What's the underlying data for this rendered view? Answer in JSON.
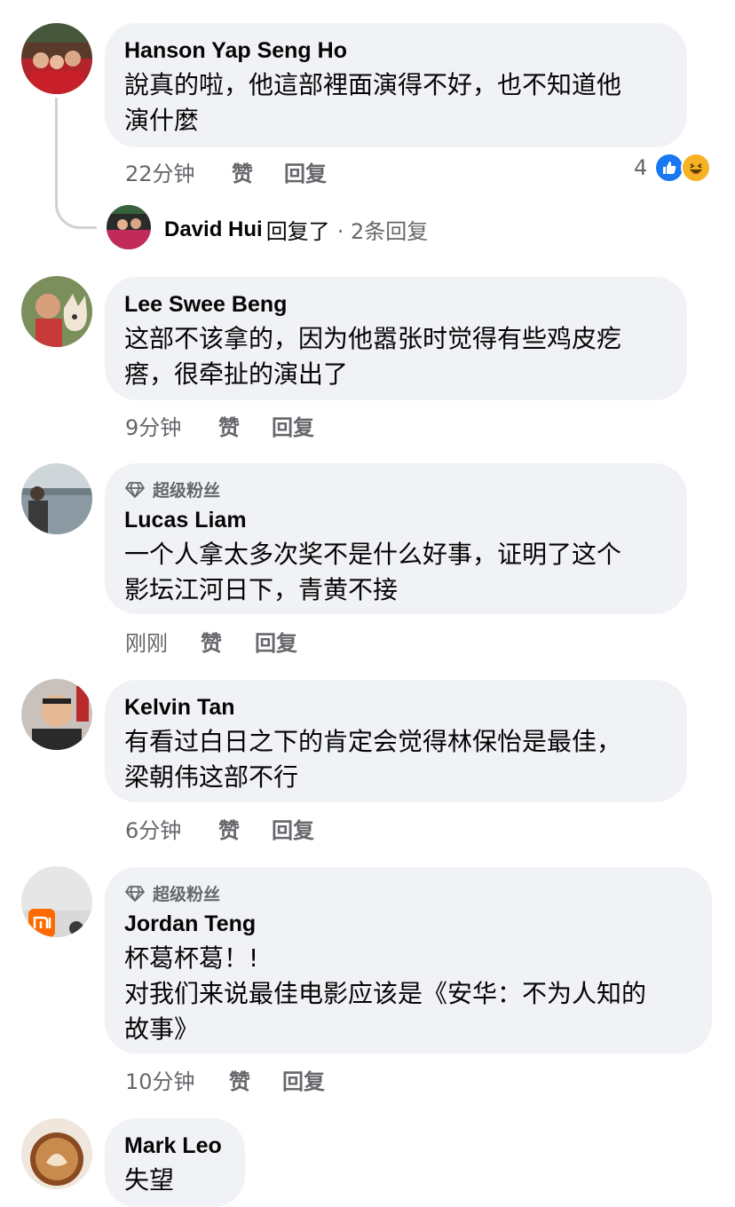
{
  "comments": [
    {
      "author": "Hanson Yap Seng Ho",
      "lines": [
        "說真的啦，他這部裡面演得不好，也不知道他",
        "演什麼"
      ],
      "time": "22分钟",
      "like": "赞",
      "reply": "回复",
      "reaction_count": "4",
      "reaction_icons": [
        "like-reaction-icon",
        "haha-reaction-icon"
      ],
      "replies_preview": {
        "author": "David Hui",
        "action": "回复了",
        "count": "· 2条回复"
      }
    },
    {
      "author": "Lee Swee Beng",
      "lines": [
        "这部不该拿的，因为他嚣张时觉得有些鸡皮疙",
        "瘩，很牵扯的演出了"
      ],
      "time": "9分钟",
      "like": "赞",
      "reply": "回复"
    },
    {
      "badge": "超级粉丝",
      "author": "Lucas Liam",
      "lines": [
        "一个人拿太多次奖不是什么好事，证明了这个",
        "影坛江河日下，青黄不接"
      ],
      "time": "刚刚",
      "like": "赞",
      "reply": "回复"
    },
    {
      "author": "Kelvin Tan",
      "lines": [
        "有看过白日之下的肯定会觉得林保怡是最佳，",
        "梁朝伟这部不行"
      ],
      "time": "6分钟",
      "like": "赞",
      "reply": "回复"
    },
    {
      "badge": "超级粉丝",
      "author": "Jordan Teng",
      "lines": [
        "杯葛杯葛！!",
        "对我们来说最佳电影应该是《安华：不为人知的",
        "故事》"
      ],
      "time": "10分钟",
      "like": "赞",
      "reply": "回复"
    },
    {
      "author": "Mark Leo",
      "lines": [
        "失望"
      ]
    }
  ],
  "colors": {
    "bubble": "#f0f2f5",
    "meta_text": "#65676b",
    "like_blue": "#1877f2",
    "haha_yellow": "#f7b125"
  }
}
